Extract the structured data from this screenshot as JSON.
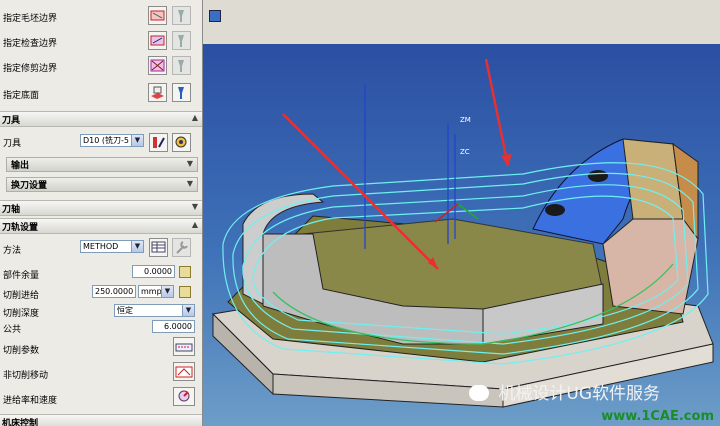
{
  "panel": {
    "geometry_rows": [
      {
        "label": "指定毛坯边界"
      },
      {
        "label": "指定检查边界"
      },
      {
        "label": "指定修剪边界"
      },
      {
        "label": "指定底面"
      }
    ],
    "tool_section": {
      "title": "刀具",
      "tool_label": "刀具",
      "tool_value": "D10 (铣刀-5",
      "output_label": "输出",
      "toolchange_label": "换刀设置"
    },
    "axis_section": {
      "title": "刀轴"
    },
    "toolpath_section": {
      "title": "刀轨设置",
      "method_label": "方法",
      "method_value": "METHOD",
      "stock_label": "部件余量",
      "stock_value": "0.0000",
      "feed_label": "切削进给",
      "feed_value": "250.0000",
      "feed_unit": "mmpm",
      "depth_label": "切削深度",
      "depth_value": "恒定",
      "common_label": "公共",
      "common_value": "6.0000",
      "cut_params_label": "切削参数",
      "noncut_label": "非切削移动",
      "feeds_label": "进给率和速度"
    },
    "machine_section": {
      "title": "机床控制"
    }
  },
  "viewport": {
    "axis_labels": {
      "zm": "ZM",
      "zc": "ZC"
    },
    "watermark_text": "机械设计UG软件服务",
    "watermark_site": "www.1CAE.com",
    "bg_color": "#2f5aa8"
  }
}
